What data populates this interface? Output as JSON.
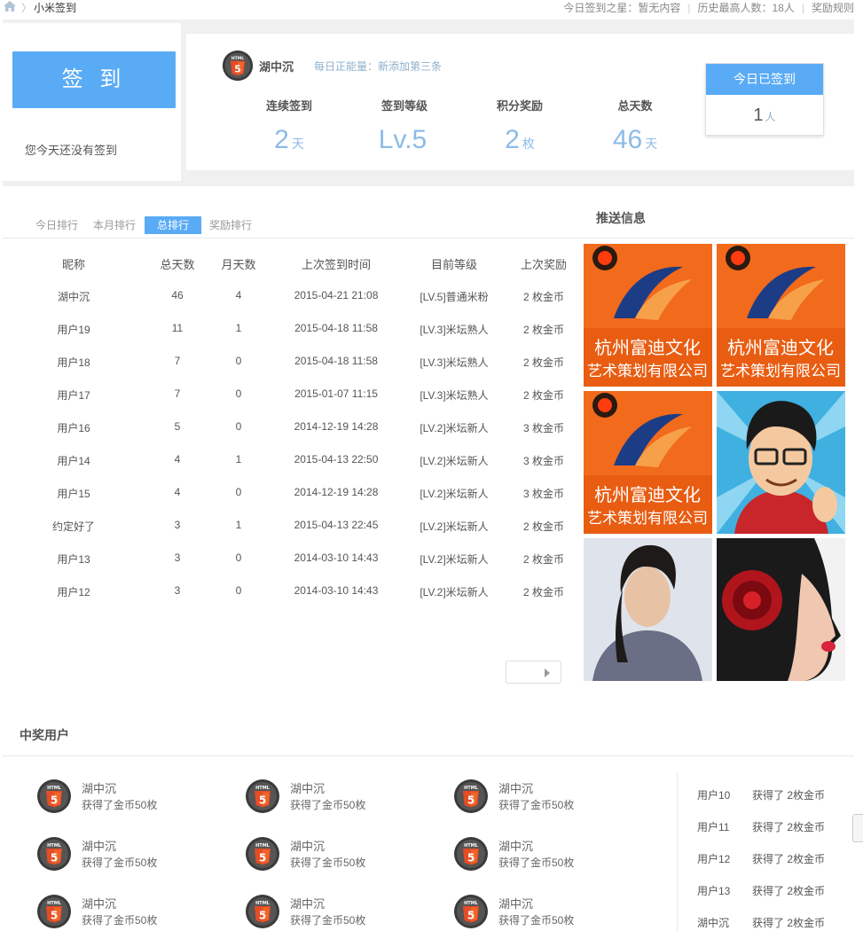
{
  "topbar": {
    "title": "小米签到",
    "star_text": "今日签到之星：暂无内容",
    "max_text": "历史最高人数：18人",
    "rules_text": "奖励规则"
  },
  "sign": {
    "button_label": "签 到",
    "status_text": "您今天还没有签到"
  },
  "user": {
    "name": "湖中沉",
    "message": "每日正能量：新添加第三条"
  },
  "stats": [
    {
      "label": "连续签到",
      "value": "2",
      "unit": "天"
    },
    {
      "label": "签到等级",
      "value": "Lv.5",
      "unit": ""
    },
    {
      "label": "积分奖励",
      "value": "2",
      "unit": "枚"
    },
    {
      "label": "总天数",
      "value": "46",
      "unit": "天"
    }
  ],
  "today": {
    "header": "今日已签到",
    "count": "1",
    "unit": "人"
  },
  "tabs": [
    "今日排行",
    "本月排行",
    "总排行",
    "奖励排行"
  ],
  "active_tab": "总排行",
  "push_title": "推送信息",
  "table": {
    "headers": [
      "昵称",
      "总天数",
      "月天数",
      "上次签到时间",
      "目前等级",
      "上次奖励"
    ],
    "rows": [
      [
        "湖中沉",
        "46",
        "4",
        "2015-04-21 21:08",
        "[LV.5]普通米粉",
        "2 枚金币"
      ],
      [
        "用户19",
        "11",
        "1",
        "2015-04-18 11:58",
        "[LV.3]米坛熟人",
        "2 枚金币"
      ],
      [
        "用户18",
        "7",
        "0",
        "2015-04-18 11:58",
        "[LV.3]米坛熟人",
        "2 枚金币"
      ],
      [
        "用户17",
        "7",
        "0",
        "2015-01-07 11:15",
        "[LV.3]米坛熟人",
        "2 枚金币"
      ],
      [
        "用户16",
        "5",
        "0",
        "2014-12-19 14:28",
        "[LV.2]米坛新人",
        "3 枚金币"
      ],
      [
        "用户14",
        "4",
        "1",
        "2015-04-13 22:50",
        "[LV.2]米坛新人",
        "3 枚金币"
      ],
      [
        "用户15",
        "4",
        "0",
        "2014-12-19 14:28",
        "[LV.2]米坛新人",
        "3 枚金币"
      ],
      [
        "约定好了",
        "3",
        "1",
        "2015-04-13 22:45",
        "[LV.2]米坛新人",
        "2 枚金币"
      ],
      [
        "用户13",
        "3",
        "0",
        "2014-03-10 14:43",
        "[LV.2]米坛新人",
        "2 枚金币"
      ],
      [
        "用户12",
        "3",
        "0",
        "2014-03-10 14:43",
        "[LV.2]米坛新人",
        "2 枚金币"
      ]
    ]
  },
  "push_ad": {
    "line1": "杭州富迪文化",
    "line2": "艺术策划有限公司"
  },
  "winners": {
    "title": "中奖用户",
    "items": [
      {
        "name": "湖中沉",
        "text": "获得了金币50枚"
      },
      {
        "name": "湖中沉",
        "text": "获得了金币50枚"
      },
      {
        "name": "湖中沉",
        "text": "获得了金币50枚"
      },
      {
        "name": "湖中沉",
        "text": "获得了金币50枚"
      },
      {
        "name": "湖中沉",
        "text": "获得了金币50枚"
      },
      {
        "name": "湖中沉",
        "text": "获得了金币50枚"
      },
      {
        "name": "湖中沉",
        "text": "获得了金币50枚"
      },
      {
        "name": "湖中沉",
        "text": "获得了金币50枚"
      },
      {
        "name": "湖中沉",
        "text": "获得了金币50枚"
      }
    ],
    "list": [
      {
        "user": "用户10",
        "text": "获得了 2枚金币"
      },
      {
        "user": "用户11",
        "text": "获得了 2枚金币"
      },
      {
        "user": "用户12",
        "text": "获得了 2枚金币"
      },
      {
        "user": "用户13",
        "text": "获得了 2枚金币"
      },
      {
        "user": "湖中沉",
        "text": "获得了 2枚金币"
      }
    ]
  },
  "colors": {
    "accent": "#5aabf5",
    "stat_value": "#8cbbe8",
    "html5_orange": "#e44d26"
  },
  "icons": [
    "home-icon",
    "html5-icon",
    "arrow-right-icon"
  ]
}
